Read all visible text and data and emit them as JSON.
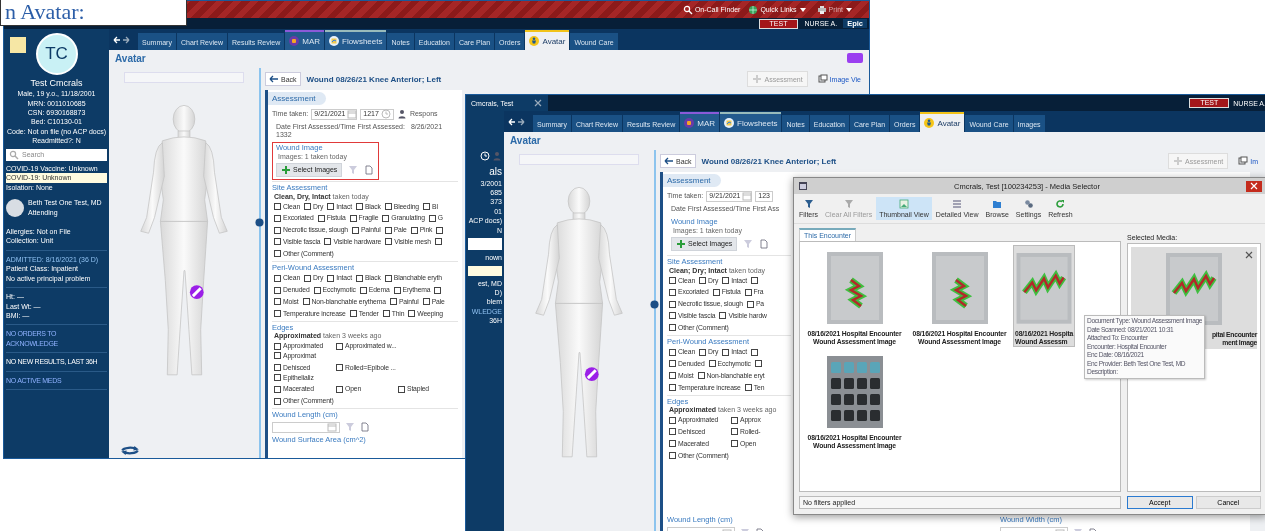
{
  "callout": {
    "text": "n Avatar:"
  },
  "window_1": {
    "toolbar_links": [
      {
        "label": "On-Call Finder",
        "kind": "search",
        "dropdown": false,
        "disabled": false
      },
      {
        "label": "Quick Links",
        "kind": "globe",
        "dropdown": true,
        "disabled": false
      },
      {
        "label": "Print",
        "kind": "printer",
        "dropdown": true,
        "disabled": true
      }
    ],
    "environment": "TEST",
    "user": "NURSE A.",
    "brand": "Epic",
    "tabs": [
      {
        "label": "Summary",
        "kind": "plain",
        "selected": false
      },
      {
        "label": "Chart Review",
        "kind": "plain",
        "selected": false
      },
      {
        "label": "Results Review",
        "kind": "plain",
        "selected": false
      },
      {
        "label": "MAR",
        "kind": "mar",
        "selected": false
      },
      {
        "label": "Flowsheets",
        "kind": "flowsheets",
        "selected": false
      },
      {
        "label": "Notes",
        "kind": "plain",
        "selected": false
      },
      {
        "label": "Education",
        "kind": "plain",
        "selected": false
      },
      {
        "label": "Care Plan",
        "kind": "plain",
        "selected": false
      },
      {
        "label": "Orders",
        "kind": "plain",
        "selected": false
      },
      {
        "label": "Avatar",
        "kind": "avatar",
        "selected": true
      },
      {
        "label": "Wound Care",
        "kind": "plain",
        "selected": false
      }
    ],
    "patient": {
      "initials": "TC",
      "name": "Test Cmcrals",
      "details": [
        "Male, 19 y.o., 11/18/2001",
        "MRN: 0011010685",
        "CSN: 6930168873",
        "Bed: C10130-01",
        "Code: Not on file (no ACP docs)",
        "Readmitted?: N"
      ]
    },
    "search": {
      "placeholder": "Search"
    },
    "flags": [
      {
        "text": "COVID-19 Vaccine: Unknown",
        "highlighted": false
      },
      {
        "text": "COVID-19: Unknown",
        "highlighted": true
      },
      {
        "text": "Isolation: None",
        "highlighted": false
      }
    ],
    "provider": {
      "name": "Beth Test One Test, MD",
      "role": "Attending"
    },
    "info_groups": [
      [
        {
          "text": "Allergies: Not on File",
          "kind": "text"
        },
        {
          "text": "Collection: Unit",
          "kind": "text"
        }
      ],
      [
        {
          "text": "ADMITTED: 8/16/2021 (36 D)",
          "kind": "link"
        },
        {
          "text": "Patient Class: Inpatient",
          "kind": "text"
        },
        {
          "text": "No active principal problem",
          "kind": "text"
        }
      ],
      [
        {
          "text": "Ht: —",
          "kind": "text"
        },
        {
          "text": "Last Wt: —",
          "kind": "text"
        },
        {
          "text": "BMI: —",
          "kind": "text"
        }
      ]
    ],
    "alerts": [
      {
        "text": "NO ORDERS TO ACKNOWLEDGE",
        "kind": "link"
      },
      {
        "text": "NO NEW RESULTS, LAST 36H",
        "kind": "text"
      },
      {
        "text": "NO ACTIVE MEDS",
        "kind": "link"
      }
    ],
    "page_title": "Avatar",
    "actions": [
      {
        "label": "Assessment",
        "disabled": true
      },
      {
        "label": "Image Vie",
        "disabled": false
      }
    ],
    "form": {
      "back": "Back",
      "title": "Wound 08/26/21 Knee Anterior; Left",
      "section": "Assessment",
      "time_label": "Time taken:",
      "date": "9/21/2021",
      "time": "1217",
      "responsible": "Respons",
      "first_assessed": {
        "label": "Date First Assessed/Time First Assessed:",
        "date": "8/26/2021",
        "time": "1332"
      },
      "wound_image": {
        "title": "Wound Image",
        "summary": "Images: 1 taken today",
        "button": "Select Images",
        "highlighted": true
      },
      "groups": [
        {
          "title": "Site Assessment",
          "summary": "**Clean, Dry, Intact** taken today",
          "kind": "flow",
          "rows": [
            {
              "options": [
                {
                  "label": "Clean",
                  "checked": false
                },
                {
                  "label": "Dry",
                  "checked": false
                },
                {
                  "label": "Intact",
                  "checked": false
                },
                {
                  "label": "Black",
                  "checked": false
                },
                {
                  "label": "Bleeding",
                  "checked": false
                },
                {
                  "label": "Bl",
                  "checked": false
                }
              ]
            },
            {
              "options": [
                {
                  "label": "Excoriated",
                  "checked": false
                },
                {
                  "label": "Fistula",
                  "checked": false
                },
                {
                  "label": "Fragile",
                  "checked": false
                },
                {
                  "label": "Granulating",
                  "checked": false
                },
                {
                  "label": "G",
                  "checked": false
                }
              ]
            },
            {
              "options": [
                {
                  "label": "Necrotic tissue, slough",
                  "checked": false
                },
                {
                  "label": "Painful",
                  "checked": false
                },
                {
                  "label": "Pale",
                  "checked": false
                },
                {
                  "label": "Pink",
                  "checked": false
                },
                {
                  "checked": false
                }
              ]
            },
            {
              "options": [
                {
                  "label": "Visible fascia",
                  "checked": false
                },
                {
                  "label": "Visible hardware",
                  "checked": false
                },
                {
                  "label": "Visible mesh",
                  "checked": false
                },
                {
                  "checked": false
                }
              ]
            },
            {
              "options": [
                {
                  "label": "Other (Comment)",
                  "checked": false
                }
              ]
            }
          ]
        },
        {
          "title": "Peri-Wound Assessment",
          "kind": "flow",
          "rows": [
            {
              "options": [
                {
                  "label": "Clean",
                  "checked": false
                },
                {
                  "label": "Dry",
                  "checked": false
                },
                {
                  "label": "Intact",
                  "checked": false
                },
                {
                  "label": "Black",
                  "checked": false
                },
                {
                  "label": "Blanchable eryth",
                  "checked": false
                }
              ]
            },
            {
              "options": [
                {
                  "label": "Denuded",
                  "checked": false
                },
                {
                  "label": "Ecchymotic",
                  "checked": false
                },
                {
                  "label": "Edema",
                  "checked": false
                },
                {
                  "label": "Erythema",
                  "checked": false
                },
                {
                  "checked": false
                }
              ]
            },
            {
              "options": [
                {
                  "label": "Moist",
                  "checked": false
                },
                {
                  "label": "Non-blanchable erythema",
                  "checked": false
                },
                {
                  "label": "Painful",
                  "checked": false
                },
                {
                  "label": "Pale",
                  "checked": false
                }
              ]
            },
            {
              "options": [
                {
                  "label": "Temperature increase",
                  "checked": false
                },
                {
                  "label": "Tender",
                  "checked": false
                },
                {
                  "label": "Thin",
                  "checked": false
                },
                {
                  "label": "Weeping",
                  "checked": false
                }
              ]
            }
          ]
        },
        {
          "title": "Edges",
          "summary": "**Approximated** taken 3 weeks ago",
          "kind": "grid",
          "rows": [
            {
              "options": [
                {
                  "label": "Approximated",
                  "checked": false
                },
                {
                  "label": "Approximated w...",
                  "checked": false
                },
                {
                  "label": "Approximat",
                  "checked": false
                }
              ]
            },
            {
              "options": [
                {
                  "label": "Dehisced",
                  "checked": false
                },
                {
                  "label": "Rolled=Epibole ...",
                  "checked": false
                },
                {
                  "label": "Epithelializ",
                  "checked": false
                }
              ]
            },
            {
              "options": [
                {
                  "label": "Macerated",
                  "checked": false
                },
                {
                  "label": "Open",
                  "checked": false
                },
                {
                  "label": "Stapled",
                  "checked": false
                }
              ]
            },
            {
              "options": [
                {
                  "label": "Other (Comment)",
                  "checked": false
                }
              ]
            }
          ]
        }
      ],
      "fields": [
        {
          "label": "Wound Length (cm)"
        }
      ],
      "next_field": "Wound Surface Area (cm^2)"
    }
  },
  "window_2": {
    "patient_tab": "Cmcrals, Test",
    "environment": "TEST",
    "user": "NURSE A.",
    "tabs": [
      {
        "label": "Summary",
        "kind": "plain",
        "selected": false
      },
      {
        "label": "Chart Review",
        "kind": "plain",
        "selected": false
      },
      {
        "label": "Results Review",
        "kind": "plain",
        "selected": false
      },
      {
        "label": "MAR",
        "kind": "mar",
        "selected": false
      },
      {
        "label": "Flowsheets",
        "kind": "flowsheets",
        "selected": false
      },
      {
        "label": "Notes",
        "kind": "plain",
        "selected": false
      },
      {
        "label": "Education",
        "kind": "plain",
        "selected": false
      },
      {
        "label": "Care Plan",
        "kind": "plain",
        "selected": false
      },
      {
        "label": "Orders",
        "kind": "plain",
        "selected": false
      },
      {
        "label": "Avatar",
        "kind": "avatar",
        "selected": true
      },
      {
        "label": "Wound Care",
        "kind": "plain",
        "selected": false
      },
      {
        "label": "Images",
        "kind": "plain",
        "selected": false
      }
    ],
    "sidebar_fragments": [
      {
        "text": "als",
        "kind": "name"
      },
      {
        "text": "3/2001",
        "kind": "text"
      },
      {
        "text": "685",
        "kind": "text"
      },
      {
        "text": "373",
        "kind": "text"
      },
      {
        "text": "01",
        "kind": "text"
      },
      {
        "text": "ACP docs)",
        "kind": "text"
      },
      {
        "text": "N",
        "kind": "text"
      },
      {
        "kind": "field"
      },
      {
        "text": "nown",
        "kind": "text"
      },
      {
        "kind": "highlight"
      },
      {
        "text": "est, MD",
        "kind": "text"
      },
      {
        "text": "D)",
        "kind": "text"
      },
      {
        "text": "blem",
        "kind": "text"
      },
      {
        "text": "WLEDGE",
        "kind": "link"
      },
      {
        "text": "36H",
        "kind": "text"
      }
    ],
    "page_title": "Avatar",
    "actions": [
      {
        "label": "Assessment",
        "disabled": true
      },
      {
        "label": "Im",
        "disabled": false
      }
    ],
    "form": {
      "back": "Back",
      "title": "Wound 08/26/21 Knee Anterior; Left",
      "section": "Assessment",
      "time_label": "Time taken:",
      "date": "9/21/2021",
      "time": "123",
      "first_assessed": {
        "label": "Date First Assessed/Time First Ass"
      },
      "wound_image": {
        "title": "Wound Image",
        "summary": "Images: 1 taken today",
        "button": "Select Images",
        "highlighted": false
      },
      "groups": [
        {
          "title": "Site Assessment",
          "summary": "**Clean; Dry; Intact** taken today",
          "kind": "flow",
          "rows": [
            {
              "options": [
                {
                  "label": "Clean",
                  "checked": false
                },
                {
                  "label": "Dry",
                  "checked": false
                },
                {
                  "label": "Intact",
                  "checked": false
                },
                {
                  "checked": false
                }
              ]
            },
            {
              "options": [
                {
                  "label": "Excoriated",
                  "checked": false
                },
                {
                  "label": "Fistula",
                  "checked": false
                },
                {
                  "label": "Fra",
                  "checked": false
                }
              ]
            },
            {
              "options": [
                {
                  "label": "Necrotic tissue, slough",
                  "checked": false
                },
                {
                  "label": "Pa",
                  "checked": false
                }
              ]
            },
            {
              "options": [
                {
                  "label": "Visible fascia",
                  "checked": false
                },
                {
                  "label": "Visible hardw",
                  "checked": false
                }
              ]
            },
            {
              "options": [
                {
                  "label": "Other (Comment)",
                  "checked": false
                }
              ]
            }
          ]
        },
        {
          "title": "Peri-Wound Assessment",
          "kind": "flow",
          "rows": [
            {
              "options": [
                {
                  "label": "Clean",
                  "checked": false
                },
                {
                  "label": "Dry",
                  "checked": false
                },
                {
                  "label": "Intact",
                  "checked": false
                },
                {
                  "checked": false
                }
              ]
            },
            {
              "options": [
                {
                  "label": "Denuded",
                  "checked": false
                },
                {
                  "label": "Ecchymotic",
                  "checked": false
                },
                {
                  "checked": false
                }
              ]
            },
            {
              "options": [
                {
                  "label": "Moist",
                  "checked": false
                },
                {
                  "label": "Non-blanchable eryt",
                  "checked": false
                }
              ]
            },
            {
              "options": [
                {
                  "label": "Temperature increase",
                  "checked": false
                },
                {
                  "label": "Ten",
                  "checked": false
                }
              ]
            }
          ]
        },
        {
          "title": "Edges",
          "summary": "**Approximated** taken 3 weeks ago",
          "kind": "grid",
          "rows": [
            {
              "options": [
                {
                  "label": "Approximated",
                  "checked": false
                },
                {
                  "label": "Approx",
                  "checked": false
                }
              ]
            },
            {
              "options": [
                {
                  "label": "Dehisced",
                  "checked": false
                },
                {
                  "label": "Rolled-",
                  "checked": false
                }
              ]
            },
            {
              "options": [
                {
                  "label": "Macerated",
                  "checked": false
                },
                {
                  "label": "Open",
                  "checked": false
                }
              ]
            },
            {
              "options": [
                {
                  "label": "Other (Comment)",
                  "checked": false
                }
              ]
            }
          ]
        }
      ],
      "fields": [
        {
          "label": "Wound Length (cm)"
        },
        {
          "label": "Wound Width (cm)"
        }
      ]
    }
  },
  "media_selector": {
    "title": "Cmcrals, Test [100234253] - Media Selector",
    "tools": [
      {
        "label": "Filters",
        "kind": "filter",
        "disabled": false,
        "selected": false
      },
      {
        "label": "Clear All Filters",
        "kind": "clear",
        "disabled": true,
        "selected": false
      },
      {
        "label": "Thumbnail View",
        "kind": "thumbnails",
        "disabled": false,
        "selected": true
      },
      {
        "label": "Detailed View",
        "kind": "list",
        "disabled": false,
        "selected": false
      },
      {
        "label": "Browse",
        "kind": "folder",
        "disabled": false,
        "selected": false
      },
      {
        "label": "Settings",
        "kind": "settings",
        "disabled": false,
        "selected": false
      },
      {
        "label": "Refresh",
        "kind": "refresh",
        "disabled": false,
        "selected": false
      }
    ],
    "tabs": [
      {
        "label": "This Encounter",
        "selected": true
      }
    ],
    "items": [
      {
        "lines": [
          "08/16/2021 Hospital Encounter",
          "Wound Assessment Image"
        ],
        "selected": false
      },
      {
        "lines": [
          "08/16/2021 Hospital Encounter",
          "Wound Assessment Image"
        ],
        "selected": false
      },
      {
        "lines": [
          "08/16/2021 Hospita",
          "Wound Assessm"
        ],
        "selected": true
      },
      {
        "lines": [
          "08/16/2021 Hospital Encounter",
          "Wound Assessment Image"
        ],
        "selected": false
      }
    ],
    "tooltip": [
      {
        "label": "Document Type:",
        "value": "Wound Assessment Image"
      },
      {
        "label": "Date Scanned:",
        "value": "08/21/2021 10:31"
      },
      {
        "label": "Attached To:",
        "value": "Encounter"
      },
      {
        "label": "Encounter:",
        "value": "Hospital Encounter"
      },
      {
        "label": "Enc Date:",
        "value": "08/16/2021"
      },
      {
        "label": "Enc Provider:",
        "value": "Beth Test One Test, MD"
      },
      {
        "label": "Description:"
      }
    ],
    "selected_media": {
      "label": "Selected Media:",
      "lines": [
        "pital Encounter",
        "ment Image"
      ]
    },
    "status": "No filters applied",
    "buttons": [
      {
        "label": "Accept",
        "default": true
      },
      {
        "label": "Cancel",
        "default": false
      }
    ]
  }
}
